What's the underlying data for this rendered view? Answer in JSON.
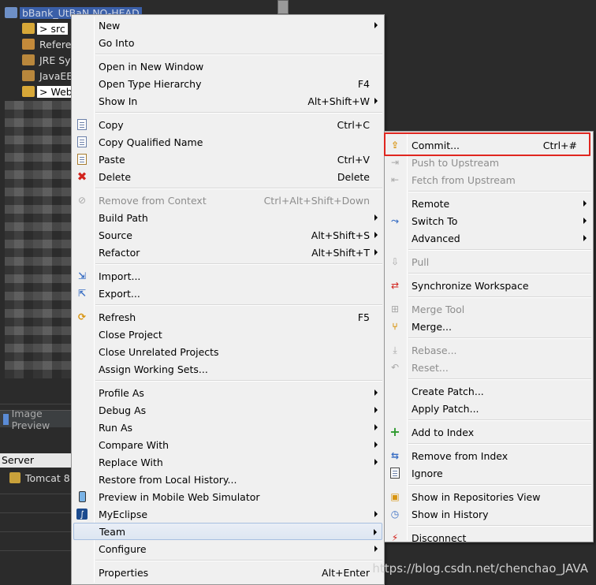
{
  "background": {
    "tree": [
      {
        "label": "bBank_UtBaN NO-HEAD",
        "name": "tree-item-project-root"
      },
      {
        "label": "> src",
        "name": "tree-item-src"
      },
      {
        "label": "Refere",
        "name": "tree-item-referenced-libraries"
      },
      {
        "label": "JRE Sy",
        "name": "tree-item-jre-system-library"
      },
      {
        "label": "JavaEE",
        "name": "tree-item-javaee"
      },
      {
        "label": "> Web",
        "name": "tree-item-webroot"
      }
    ],
    "image_preview_tab": "Image Preview",
    "server_header": "Server",
    "tomcat_label": "Tomcat  8"
  },
  "main_menu": {
    "items": [
      {
        "label": "New",
        "shortcut": "",
        "submenu": true,
        "icon": "",
        "disabled": false,
        "name": "menu-item-new"
      },
      {
        "label": "Go Into",
        "shortcut": "",
        "submenu": false,
        "icon": "",
        "disabled": false,
        "name": "menu-item-go-into"
      },
      {
        "label": "Open in New Window",
        "shortcut": "",
        "submenu": false,
        "icon": "",
        "disabled": false,
        "name": "menu-item-open-new-window"
      },
      {
        "label": "Open Type Hierarchy",
        "shortcut": "F4",
        "submenu": false,
        "icon": "",
        "disabled": false,
        "name": "menu-item-open-type-hierarchy"
      },
      {
        "label": "Show In",
        "shortcut": "Alt+Shift+W",
        "submenu": true,
        "icon": "",
        "disabled": false,
        "name": "menu-item-show-in"
      },
      {
        "label": "Copy",
        "shortcut": "Ctrl+C",
        "submenu": false,
        "icon": "copy-icon",
        "disabled": false,
        "name": "menu-item-copy"
      },
      {
        "label": "Copy Qualified Name",
        "shortcut": "",
        "submenu": false,
        "icon": "copy-qualified-name-icon",
        "disabled": false,
        "name": "menu-item-copy-qualified-name"
      },
      {
        "label": "Paste",
        "shortcut": "Ctrl+V",
        "submenu": false,
        "icon": "paste-icon",
        "disabled": false,
        "name": "menu-item-paste"
      },
      {
        "label": "Delete",
        "shortcut": "Delete",
        "submenu": false,
        "icon": "delete-icon",
        "disabled": false,
        "name": "menu-item-delete"
      },
      {
        "label": "Remove from Context",
        "shortcut": "Ctrl+Alt+Shift+Down",
        "submenu": false,
        "icon": "remove-context-icon",
        "disabled": true,
        "name": "menu-item-remove-from-context"
      },
      {
        "label": "Build Path",
        "shortcut": "",
        "submenu": true,
        "icon": "",
        "disabled": false,
        "name": "menu-item-build-path"
      },
      {
        "label": "Source",
        "shortcut": "Alt+Shift+S",
        "submenu": true,
        "icon": "",
        "disabled": false,
        "name": "menu-item-source"
      },
      {
        "label": "Refactor",
        "shortcut": "Alt+Shift+T",
        "submenu": true,
        "icon": "",
        "disabled": false,
        "name": "menu-item-refactor"
      },
      {
        "label": "Import...",
        "shortcut": "",
        "submenu": false,
        "icon": "import-icon",
        "disabled": false,
        "name": "menu-item-import"
      },
      {
        "label": "Export...",
        "shortcut": "",
        "submenu": false,
        "icon": "export-icon",
        "disabled": false,
        "name": "menu-item-export"
      },
      {
        "label": "Refresh",
        "shortcut": "F5",
        "submenu": false,
        "icon": "refresh-icon",
        "disabled": false,
        "name": "menu-item-refresh"
      },
      {
        "label": "Close Project",
        "shortcut": "",
        "submenu": false,
        "icon": "",
        "disabled": false,
        "name": "menu-item-close-project"
      },
      {
        "label": "Close Unrelated Projects",
        "shortcut": "",
        "submenu": false,
        "icon": "",
        "disabled": false,
        "name": "menu-item-close-unrelated-projects"
      },
      {
        "label": "Assign Working Sets...",
        "shortcut": "",
        "submenu": false,
        "icon": "",
        "disabled": false,
        "name": "menu-item-assign-working-sets"
      },
      {
        "label": "Profile As",
        "shortcut": "",
        "submenu": true,
        "icon": "",
        "disabled": false,
        "name": "menu-item-profile-as"
      },
      {
        "label": "Debug As",
        "shortcut": "",
        "submenu": true,
        "icon": "",
        "disabled": false,
        "name": "menu-item-debug-as"
      },
      {
        "label": "Run As",
        "shortcut": "",
        "submenu": true,
        "icon": "",
        "disabled": false,
        "name": "menu-item-run-as"
      },
      {
        "label": "Compare With",
        "shortcut": "",
        "submenu": true,
        "icon": "",
        "disabled": false,
        "name": "menu-item-compare-with"
      },
      {
        "label": "Replace With",
        "shortcut": "",
        "submenu": true,
        "icon": "",
        "disabled": false,
        "name": "menu-item-replace-with"
      },
      {
        "label": "Restore from Local History...",
        "shortcut": "",
        "submenu": false,
        "icon": "",
        "disabled": false,
        "name": "menu-item-restore-local-history"
      },
      {
        "label": "Preview in Mobile Web Simulator",
        "shortcut": "",
        "submenu": false,
        "icon": "mobile-phone-icon",
        "disabled": false,
        "name": "menu-item-preview-mobile"
      },
      {
        "label": "MyEclipse",
        "shortcut": "",
        "submenu": true,
        "icon": "myeclipse-icon",
        "disabled": false,
        "name": "menu-item-myeclipse"
      },
      {
        "label": "Team",
        "shortcut": "",
        "submenu": true,
        "icon": "",
        "disabled": false,
        "name": "menu-item-team"
      },
      {
        "label": "Configure",
        "shortcut": "",
        "submenu": true,
        "icon": "",
        "disabled": false,
        "name": "menu-item-configure"
      },
      {
        "label": "Properties",
        "shortcut": "Alt+Enter",
        "submenu": false,
        "icon": "",
        "disabled": false,
        "name": "menu-item-properties"
      }
    ]
  },
  "team_menu": {
    "items": [
      {
        "label": "Commit...",
        "shortcut": "Ctrl+#",
        "submenu": false,
        "icon": "commit-icon",
        "disabled": false,
        "name": "team-item-commit"
      },
      {
        "label": "Push to Upstream",
        "shortcut": "",
        "submenu": false,
        "icon": "push-icon",
        "disabled": true,
        "name": "team-item-push-upstream"
      },
      {
        "label": "Fetch from Upstream",
        "shortcut": "",
        "submenu": false,
        "icon": "fetch-icon",
        "disabled": true,
        "name": "team-item-fetch-upstream"
      },
      {
        "label": "Remote",
        "shortcut": "",
        "submenu": true,
        "icon": "",
        "disabled": false,
        "name": "team-item-remote"
      },
      {
        "label": "Switch To",
        "shortcut": "",
        "submenu": true,
        "icon": "switch-branch-icon",
        "disabled": false,
        "name": "team-item-switch-to"
      },
      {
        "label": "Advanced",
        "shortcut": "",
        "submenu": true,
        "icon": "",
        "disabled": false,
        "name": "team-item-advanced"
      },
      {
        "label": "Pull",
        "shortcut": "",
        "submenu": false,
        "icon": "pull-icon",
        "disabled": true,
        "name": "team-item-pull"
      },
      {
        "label": "Synchronize Workspace",
        "shortcut": "",
        "submenu": false,
        "icon": "synchronize-icon",
        "disabled": false,
        "name": "team-item-synchronize"
      },
      {
        "label": "Merge Tool",
        "shortcut": "",
        "submenu": false,
        "icon": "merge-tool-icon",
        "disabled": true,
        "name": "team-item-merge-tool"
      },
      {
        "label": "Merge...",
        "shortcut": "",
        "submenu": false,
        "icon": "merge-icon",
        "disabled": false,
        "name": "team-item-merge"
      },
      {
        "label": "Rebase...",
        "shortcut": "",
        "submenu": false,
        "icon": "rebase-icon",
        "disabled": true,
        "name": "team-item-rebase"
      },
      {
        "label": "Reset...",
        "shortcut": "",
        "submenu": false,
        "icon": "reset-icon",
        "disabled": true,
        "name": "team-item-reset"
      },
      {
        "label": "Create Patch...",
        "shortcut": "",
        "submenu": false,
        "icon": "",
        "disabled": false,
        "name": "team-item-create-patch"
      },
      {
        "label": "Apply Patch...",
        "shortcut": "",
        "submenu": false,
        "icon": "",
        "disabled": false,
        "name": "team-item-apply-patch"
      },
      {
        "label": "Add to Index",
        "shortcut": "",
        "submenu": false,
        "icon": "add-index-icon",
        "disabled": false,
        "name": "team-item-add-to-index"
      },
      {
        "label": "Remove from Index",
        "shortcut": "",
        "submenu": false,
        "icon": "remove-index-icon",
        "disabled": false,
        "name": "team-item-remove-from-index"
      },
      {
        "label": "Ignore",
        "shortcut": "",
        "submenu": false,
        "icon": "ignore-icon",
        "disabled": false,
        "name": "team-item-ignore"
      },
      {
        "label": "Show in Repositories View",
        "shortcut": "",
        "submenu": false,
        "icon": "repositories-view-icon",
        "disabled": false,
        "name": "team-item-show-repositories"
      },
      {
        "label": "Show in History",
        "shortcut": "",
        "submenu": false,
        "icon": "history-icon",
        "disabled": false,
        "name": "team-item-show-history"
      },
      {
        "label": "Disconnect",
        "shortcut": "",
        "submenu": false,
        "icon": "disconnect-icon",
        "disabled": false,
        "name": "team-item-disconnect"
      }
    ]
  },
  "highlight_color": "#e0261f",
  "watermark": "https://blog.csdn.net/chenchao_JAVA"
}
